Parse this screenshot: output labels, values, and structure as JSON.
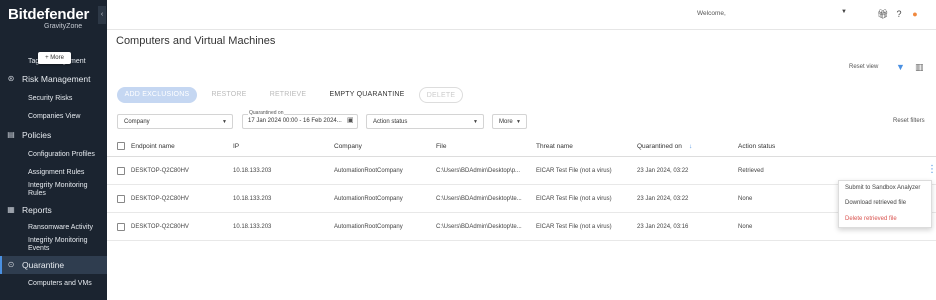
{
  "app": {
    "brand": "Bitdefender",
    "product": "GravityZone"
  },
  "sidebar": {
    "more_chip": "+ More",
    "items": [
      {
        "label": "Tags Management",
        "type": "sub"
      },
      {
        "label": "Risk Management",
        "type": "section",
        "icon": "risk-icon"
      },
      {
        "label": "Security Risks",
        "type": "sub"
      },
      {
        "label": "Companies View",
        "type": "sub"
      },
      {
        "label": "Policies",
        "type": "section",
        "icon": "policies-icon"
      },
      {
        "label": "Configuration Profiles",
        "type": "sub"
      },
      {
        "label": "Assignment Rules",
        "type": "sub"
      },
      {
        "label": "Integrity Monitoring Rules",
        "type": "sub"
      },
      {
        "label": "Reports",
        "type": "section",
        "icon": "reports-icon"
      },
      {
        "label": "Ransomware Activity",
        "type": "sub"
      },
      {
        "label": "Integrity Monitoring Events",
        "type": "sub"
      },
      {
        "label": "Quarantine",
        "type": "section",
        "icon": "quarantine-icon",
        "active": true
      },
      {
        "label": "Computers and VMs",
        "type": "sub"
      }
    ]
  },
  "topbar": {
    "welcome": "Welcome,"
  },
  "page": {
    "title": "Computers and Virtual Machines"
  },
  "view": {
    "reset_view": "Reset view"
  },
  "actions": {
    "add_exclusions": "ADD EXCLUSIONS",
    "restore": "RESTORE",
    "retrieve": "RETRIEVE",
    "empty_quarantine": "EMPTY QUARANTINE",
    "delete": "DELETE"
  },
  "filters": {
    "company": "Company",
    "quarantined_on_label": "Quarantined on",
    "quarantined_on_value": "17 Jan 2024 00:00 - 16 Feb 2024...",
    "action_status": "Action status",
    "more": "More",
    "reset_filters": "Reset filters"
  },
  "table": {
    "columns": [
      "Endpoint name",
      "IP",
      "Company",
      "File",
      "Threat name",
      "Quarantined on",
      "Action status"
    ],
    "sort_indicator": "↓",
    "rows": [
      {
        "endpoint": "DESKTOP-Q2C80HV",
        "ip": "10.18.133.203",
        "company": "AutomationRootCompany",
        "file": "C:\\Users\\BDAdmin\\Desktop\\p...",
        "threat": "EICAR Test File (not a virus)",
        "quarantined": "23 Jan 2024, 03:22",
        "status": "Retrieved"
      },
      {
        "endpoint": "DESKTOP-Q2C80HV",
        "ip": "10.18.133.203",
        "company": "AutomationRootCompany",
        "file": "C:\\Users\\BDAdmin\\Desktop\\te...",
        "threat": "EICAR Test File (not a virus)",
        "quarantined": "23 Jan 2024, 03:22",
        "status": "None"
      },
      {
        "endpoint": "DESKTOP-Q2C80HV",
        "ip": "10.18.133.203",
        "company": "AutomationRootCompany",
        "file": "C:\\Users\\BDAdmin\\Desktop\\te...",
        "threat": "EICAR Test File (not a virus)",
        "quarantined": "23 Jan 2024, 03:16",
        "status": "None"
      }
    ]
  },
  "context_menu": {
    "items": [
      "Submit to Sandbox Analyzer",
      "Download retrieved file",
      "Delete retrieved file"
    ]
  },
  "colors": {
    "accent": "#4a90e2",
    "sidebar_bg": "#1b2430",
    "danger": "#d9534f"
  }
}
